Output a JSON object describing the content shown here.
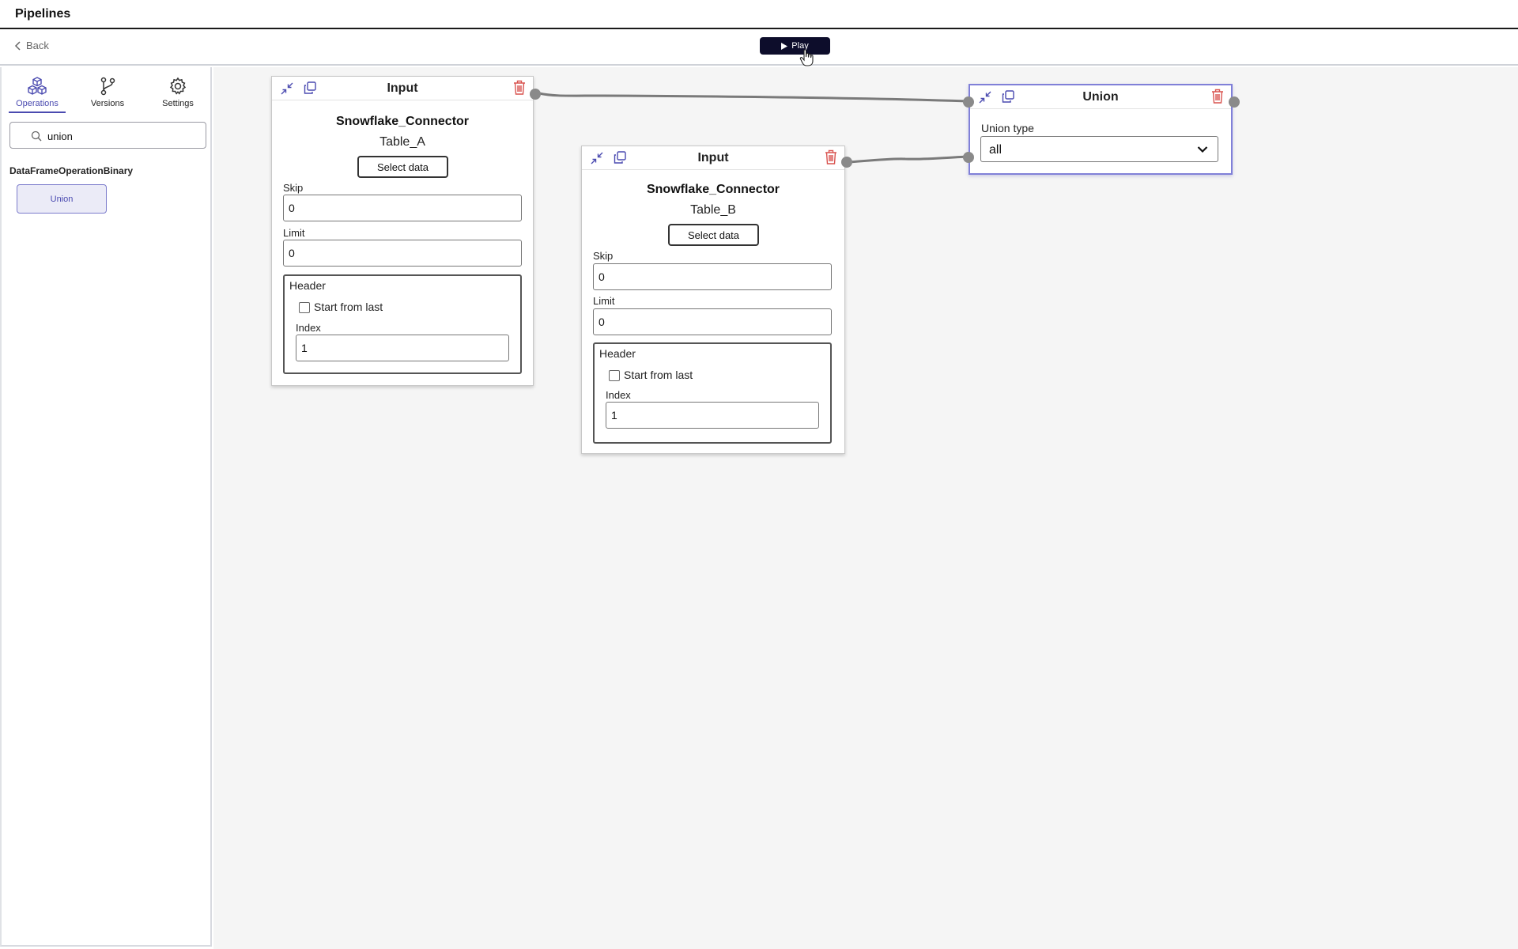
{
  "app": {
    "title": "Pipelines"
  },
  "toolbar": {
    "back_label": "Back",
    "play_label": "Play"
  },
  "sidebar": {
    "tabs": [
      {
        "label": "Operations",
        "icon": "cubes-icon",
        "active": true
      },
      {
        "label": "Versions",
        "icon": "branch-icon",
        "active": false
      },
      {
        "label": "Settings",
        "icon": "gear-icon",
        "active": false
      }
    ],
    "search": {
      "value": "union",
      "placeholder": ""
    },
    "category": "DataFrameOperationBinary",
    "operations": [
      {
        "label": "Union"
      }
    ]
  },
  "nodes": {
    "input_a": {
      "title": "Input",
      "connector": "Snowflake_Connector",
      "table": "Table_A",
      "select_label": "Select data",
      "skip_label": "Skip",
      "skip_value": "0",
      "limit_label": "Limit",
      "limit_value": "0",
      "header_label": "Header",
      "start_from_last_label": "Start from last",
      "start_from_last_checked": false,
      "index_label": "Index",
      "index_value": "1"
    },
    "input_b": {
      "title": "Input",
      "connector": "Snowflake_Connector",
      "table": "Table_B",
      "select_label": "Select data",
      "skip_label": "Skip",
      "skip_value": "0",
      "limit_label": "Limit",
      "limit_value": "0",
      "header_label": "Header",
      "start_from_last_label": "Start from last",
      "start_from_last_checked": false,
      "index_label": "Index",
      "index_value": "1"
    },
    "union": {
      "title": "Union",
      "type_label": "Union type",
      "type_value": "all"
    }
  },
  "colors": {
    "accent": "#4a4ab0",
    "play_button": "#0d0d2b",
    "delete_icon": "#d9534f",
    "canvas_bg": "#f5f5f5",
    "edge": "#7a7a7a"
  }
}
